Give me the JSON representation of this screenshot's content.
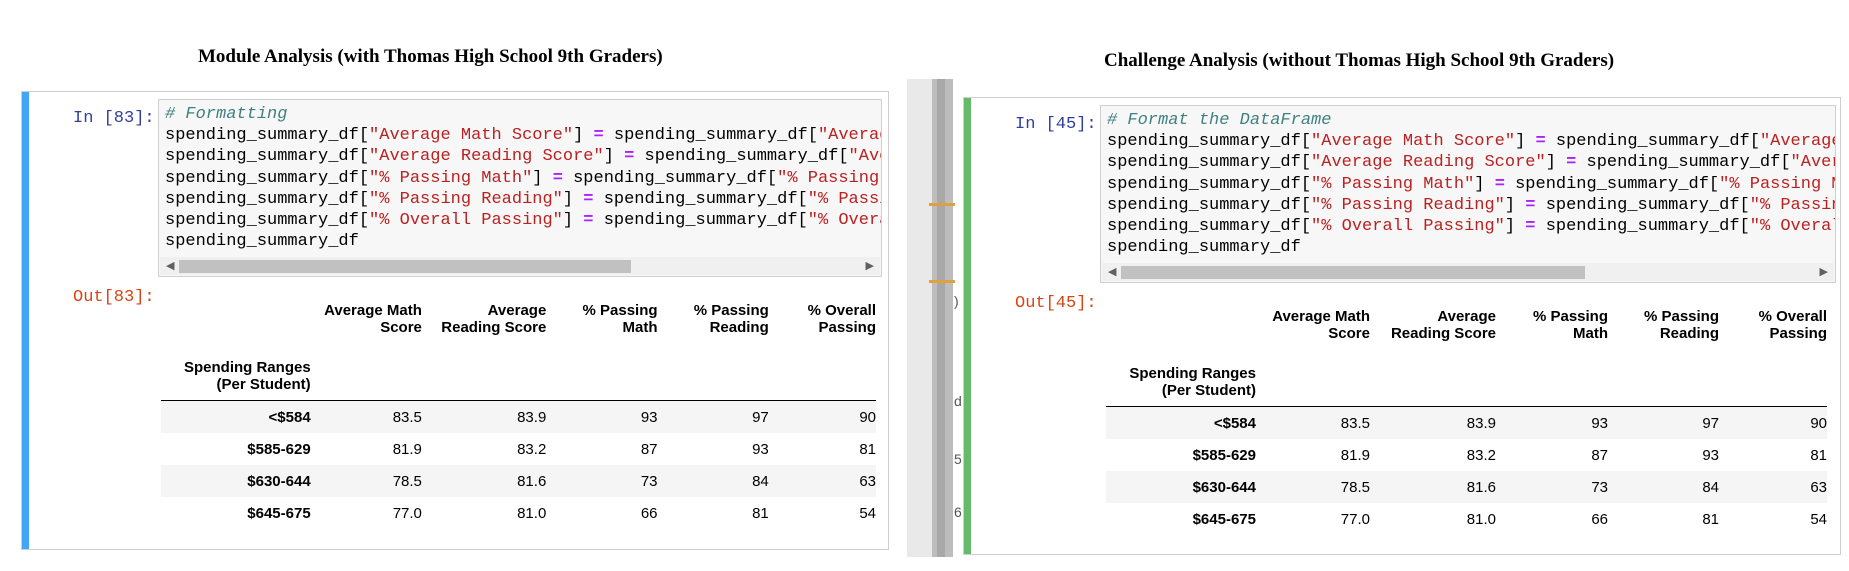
{
  "left_panel": {
    "title": "Module Analysis (with Thomas High School 9th Graders)",
    "bar_color": "#42a5f5",
    "in_prompt": "In [83]:",
    "out_prompt": "Out[83]:",
    "code_comment": "# Formatting",
    "code_lines": [
      {
        "pre": "spending_summary_df[",
        "key": "\"Average Math Score\"",
        "mid": "] ",
        "op": "=",
        "post": " spending_summary_df[",
        "tail": "\"Average Ma"
      },
      {
        "pre": "spending_summary_df[",
        "key": "\"Average Reading Score\"",
        "mid": "] ",
        "op": "=",
        "post": " spending_summary_df[",
        "tail": "\"Average"
      },
      {
        "pre": "spending_summary_df[",
        "key": "\"% Passing Math\"",
        "mid": "] ",
        "op": "=",
        "post": " spending_summary_df[",
        "tail": "\"% Passing Math"
      },
      {
        "pre": "spending_summary_df[",
        "key": "\"% Passing Reading\"",
        "mid": "] ",
        "op": "=",
        "post": " spending_summary_df[",
        "tail": "\"% Passing F"
      },
      {
        "pre": "spending_summary_df[",
        "key": "\"% Overall Passing\"",
        "mid": "] ",
        "op": "=",
        "post": " spending_summary_df[",
        "tail": "\"% Overall P"
      }
    ],
    "code_last": "spending_summary_df"
  },
  "right_panel": {
    "title": "Challenge Analysis (without Thomas High School 9th Graders)",
    "bar_color": "#66bb6a",
    "in_prompt": "In [45]:",
    "out_prompt": "Out[45]:",
    "code_comment": "# Format the DataFrame",
    "code_lines": [
      {
        "pre": "spending_summary_df[",
        "key": "\"Average Math Score\"",
        "mid": "] ",
        "op": "=",
        "post": " spending_summary_df[",
        "tail": "\"Average Mat"
      },
      {
        "pre": "spending_summary_df[",
        "key": "\"Average Reading Score\"",
        "mid": "] ",
        "op": "=",
        "post": " spending_summary_df[",
        "tail": "\"Average"
      },
      {
        "pre": "spending_summary_df[",
        "key": "\"% Passing Math\"",
        "mid": "] ",
        "op": "=",
        "post": " spending_summary_df[",
        "tail": "\"% Passing Math\""
      },
      {
        "pre": "spending_summary_df[",
        "key": "\"% Passing Reading\"",
        "mid": "] ",
        "op": "=",
        "post": " spending_summary_df[",
        "tail": "\"% Passing Re"
      },
      {
        "pre": "spending_summary_df[",
        "key": "\"% Overall Passing\"",
        "mid": "] ",
        "op": "=",
        "post": " spending_summary_df[",
        "tail": "\"% Overall Pa"
      }
    ],
    "code_last": "spending_summary_df"
  },
  "table": {
    "index_name_line1": "Spending Ranges",
    "index_name_line2": "(Per Student)",
    "columns": [
      {
        "line1": "Average Math",
        "line2": "Score"
      },
      {
        "line1": "Average",
        "line2": "Reading Score"
      },
      {
        "line1": "% Passing",
        "line2": "Math"
      },
      {
        "line1": "% Passing",
        "line2": "Reading"
      },
      {
        "line1": "% Overall",
        "line2": "Passing"
      }
    ],
    "rows": [
      {
        "label": "<$584",
        "values": [
          "83.5",
          "83.9",
          "93",
          "97",
          "90"
        ]
      },
      {
        "label": "$585-629",
        "values": [
          "81.9",
          "83.2",
          "87",
          "93",
          "81"
        ]
      },
      {
        "label": "$630-644",
        "values": [
          "78.5",
          "81.6",
          "73",
          "84",
          "63"
        ]
      },
      {
        "label": "$645-675",
        "values": [
          "77.0",
          "81.0",
          "66",
          "81",
          "54"
        ]
      }
    ]
  },
  "divider_glyphs": [
    ")",
    "d",
    "5",
    "6"
  ]
}
